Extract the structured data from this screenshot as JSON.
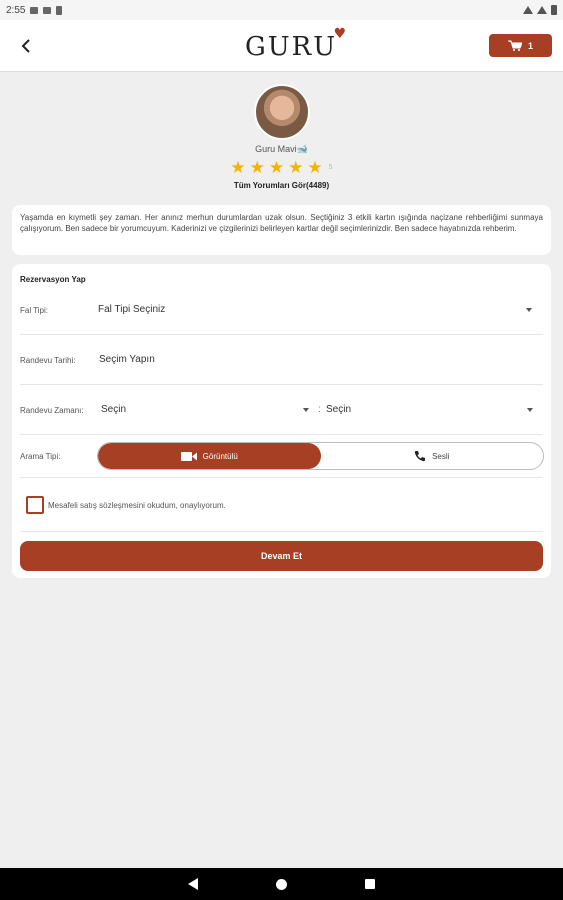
{
  "status_bar": {
    "time": "2:55"
  },
  "header": {
    "logo_text": "GURU",
    "cart_count": "1",
    "accent_color": "#a63f24"
  },
  "profile": {
    "name": "Guru Mavi🐋",
    "rating_stars": 5,
    "rating_text": "5",
    "reviews_link": "Tüm Yorumları Gör(4489)"
  },
  "description": "Yaşamda en kıymetli şey zaman. Her anınız merhun durumlardan uzak olsun. Seçtiğiniz 3 etkili kartın ışığında naçizane rehberliğimi sunmaya çalışıyorum. Ben sadece bir yorumcuyum. Kaderinizi ve çizgilerinizi belirleyen kartlar değil seçimlerinizdir. Ben sadece hayatınızda rehberim.",
  "form": {
    "title": "Rezervasyon Yap",
    "fal_tipi_label": "Fal Tipi:",
    "fal_tipi_value": "Fal Tipi Seçiniz",
    "randevu_tarihi_label": "Randevu Tarihi:",
    "randevu_tarihi_value": "Seçim Yapın",
    "randevu_zamani_label": "Randevu Zamanı:",
    "randevu_zamani_start": "Seçin",
    "time_separator": ":",
    "randevu_zamani_end": "Seçin",
    "arama_tipi_label": "Arama Tipi:",
    "arama_options": [
      "Görüntülü",
      "Sesli"
    ],
    "arama_selected": "Görüntülü",
    "checkbox_label": "Mesafeli satış sözleşmesini okudum, onaylıyorum.",
    "continue_button": "Devam Et"
  }
}
